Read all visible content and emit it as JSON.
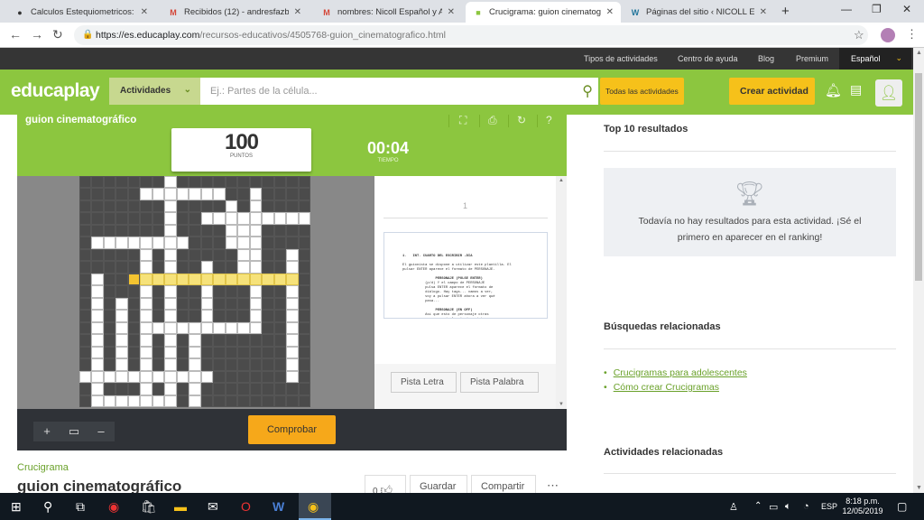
{
  "browser": {
    "tabs": [
      {
        "title": "Calculos Estequiometricos: MC",
        "icon": "github-icon"
      },
      {
        "title": "Recibidos (12) - andresfazbear",
        "icon": "gmail-icon"
      },
      {
        "title": "nombres: Nicoll Español y And",
        "icon": "gmail-icon"
      },
      {
        "title": "Crucigrama: guion cinematog",
        "icon": "educaplay-icon",
        "active": true
      },
      {
        "title": "Páginas del sitio ‹ NICOLL ESP",
        "icon": "wordpress-icon"
      }
    ],
    "url_host": "https://es.educaplay.com",
    "url_path": "/recursos-educativos/4505768-guion_cinematografico.html"
  },
  "util_nav": {
    "tipos": "Tipos de actividades",
    "ayuda": "Centro de ayuda",
    "blog": "Blog",
    "premium": "Premium",
    "idioma": "Español"
  },
  "header": {
    "logo": "educaplay",
    "actividades": "Actividades",
    "search_placeholder": "Ej.: Partes de la célula...",
    "todas": "Todas las actividades",
    "crear": "Crear actividad"
  },
  "game": {
    "title": "guion cinematográfico",
    "score": "100",
    "score_label": "PUNTOS",
    "time": "00:04",
    "time_label": "TIEMPO",
    "page_number": "1",
    "hint_letter": "Pista Letra",
    "hint_word": "Pista Palabra",
    "check": "Comprobar",
    "doc_lines": [
      "1.   INT. CUARTO DEL ESCRIBIR -DIA",
      "",
      "El guionista se dispone a utilizar este plantilla. El",
      "pulsar ENTER aparece el formato de PERSONAJE.",
      "",
      "                PERSONAJE (PULSE ENTER)",
      "           (p/d) Y el campo de PERSONAJE",
      "           pulsa ENTER aparece el formato de",
      "           diálogo. Hay tags... vamos a ver,",
      "           voy a pulsar ENTER ahora a ver qué",
      "           pasa...",
      "",
      "                PERSONAJE (EN OFF)",
      "           Así que esto de personaje otras",
      "           cosas... si el paisaje sujeto a",
      "           escena y escribir la buena en el",
      "           cuadrito de formato."
    ],
    "zoom_in": "+",
    "zoom_fit": "▭",
    "zoom_out": "–"
  },
  "below_game": {
    "category": "Crucigrama",
    "title": "guion cinematográfico",
    "likes": "0",
    "guardar": "Guardar",
    "compartir": "Compartir"
  },
  "right": {
    "top10": "Top 10 resultados",
    "no_results": "Todavía no hay resultados para esta actividad. ¡Sé el primero en aparecer en el ranking!",
    "busquedas": "Búsquedas relacionadas",
    "links": [
      "Crucigramas para adolescentes",
      "Cómo crear Crucigramas"
    ],
    "actividades": "Actividades relacionadas"
  },
  "taskbar": {
    "lang": "ESP",
    "time": "8:18 p.m.",
    "date": "12/05/2019"
  }
}
